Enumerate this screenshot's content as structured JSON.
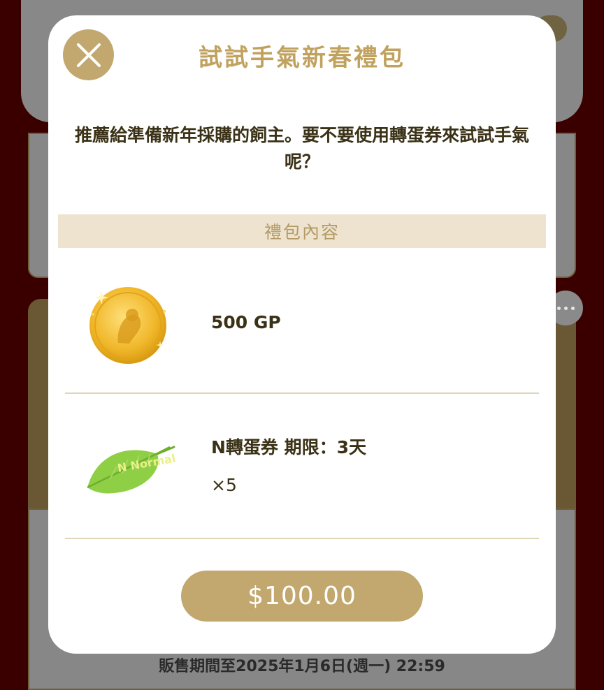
{
  "modal": {
    "title": "試試手氣新春禮包",
    "description": "推薦給準備新年採購的飼主。要不要使用轉蛋券來試試手氣呢？",
    "section_title": "禮包內容",
    "items": [
      {
        "icon": "gold-coin-icon",
        "name": "500 GP",
        "quantity": ""
      },
      {
        "icon": "green-leaf-ticket-icon",
        "name": "N轉蛋券 期限：3天",
        "quantity": "×5",
        "icon_text": "N Normal"
      }
    ],
    "price_label": "$100.00"
  },
  "background": {
    "sale_period": "販售期間至2025年1月6日(週一) 22:59"
  },
  "colors": {
    "accent_gold": "#c2a86e",
    "title_gold": "#c0a25e",
    "section_bg": "#ede3cf",
    "text_dark": "#3a3116",
    "backdrop": "#3a0000"
  }
}
